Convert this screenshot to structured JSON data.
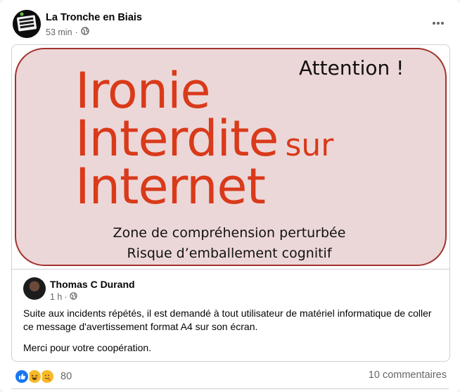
{
  "post": {
    "page_name": "La Tronche en Biais",
    "time": "53 min",
    "audience_icon": "globe-icon",
    "more_icon": "more-horizontal-icon"
  },
  "banner": {
    "attention": "Attention !",
    "line1": "Ironie",
    "line2": "Interdite",
    "line2_small": "sur",
    "line3": "Internet",
    "zone1": "Zone de compréhension perturbée",
    "zone2": "Risque d’emballement cognitif",
    "colors": {
      "title": "#d93a1a",
      "border": "#a3322d",
      "fill": "#ecd7d8"
    }
  },
  "shared": {
    "author_name": "Thomas C Durand",
    "time": "1 h",
    "audience_icon": "globe-icon",
    "message_p1": "Suite aux incidents répétés, il est demandé à tout utilisateur de matériel informatique de coller ce message d'avertissement format A4 sur son écran.",
    "message_p2": "Merci pour votre coopération."
  },
  "footer": {
    "reaction_icons": [
      "like-icon",
      "haha-icon",
      "care-icon"
    ],
    "reaction_count": "80",
    "comments": "10 commentaires"
  }
}
